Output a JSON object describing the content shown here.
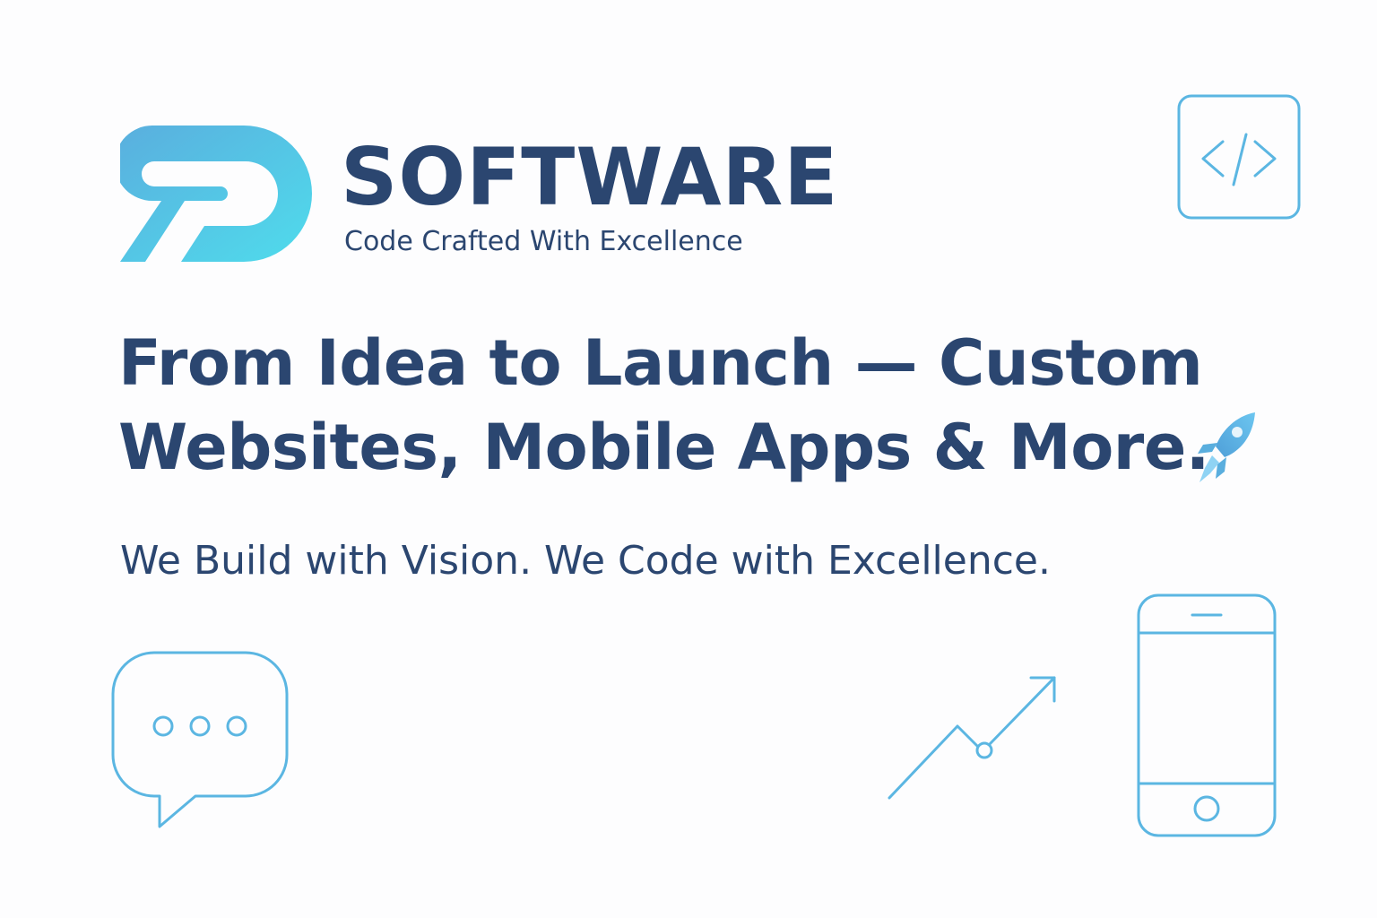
{
  "brand": {
    "name": "SOFTWARE",
    "tagline": "Code Crafted With Excellence",
    "logo_icon": "sp-monogram-logo",
    "gradient_start": "#5aaede",
    "gradient_end": "#4fdcec"
  },
  "hero": {
    "headline_line1": "From Idea to Launch — Custom",
    "headline_line2": "Websites, Mobile Apps & More.",
    "subheadline": "We Build with Vision. We Code with Excellence.",
    "accent_icon": "rocket-icon"
  },
  "icons": {
    "code": "code-icon",
    "chat": "chat-bubble-icon",
    "trend": "trend-arrow-icon",
    "phone": "smartphone-icon"
  },
  "colors": {
    "text": "#2b4670",
    "icon_stroke": "#5bb6e2",
    "background": "#fdfdfe"
  }
}
